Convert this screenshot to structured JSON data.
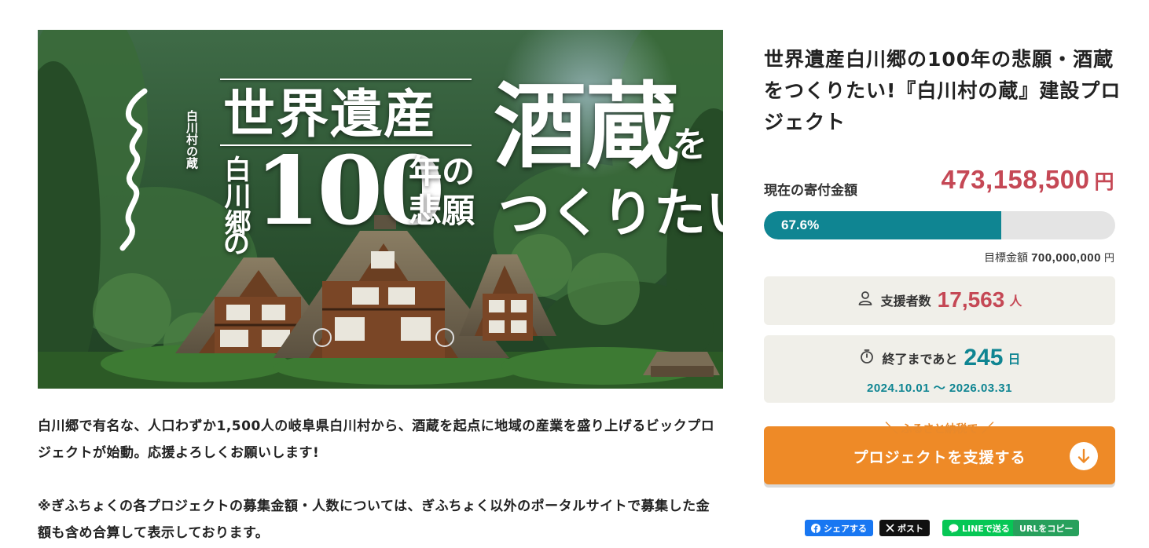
{
  "hero": {
    "alt": "世界遺産白川郷の100年の悲願 酒蔵をつくりたい!",
    "heritage": "世界遺産",
    "village": "白川郷",
    "of": "の",
    "hundred": "100",
    "years": "年の",
    "wish": "悲願",
    "sake": "酒蔵",
    "wo": "を",
    "want": "つくりたい!",
    "brand": "白川村の蔵"
  },
  "description": {
    "para1": "白川郷で有名な、人口わずか1,500人の岐阜県白川村から、酒蔵を起点に地域の産業を盛り上げるビックプロジェクトが始動。応援よろしくお願いします!",
    "para2": "※ぎふちょくの各プロジェクトの募集金額・人数については、ぎふちょく以外のポータルサイトで募集した金額も含め合算して表示しております。"
  },
  "project": {
    "title": "世界遺産白川郷の100年の悲願・酒蔵をつくりたい!『白川村の蔵』建設プロジェクト"
  },
  "funding": {
    "label": "現在の寄付金額",
    "amount": "473,158,500",
    "unit": "円",
    "percent": "67.6%",
    "percent_value": 67.6,
    "goal_label": "目標金額",
    "goal_amount": "700,000,000",
    "goal_unit": "円"
  },
  "supporters": {
    "label": "支援者数",
    "count": "17,563",
    "unit": "人"
  },
  "remaining": {
    "label": "終了まであと",
    "days": "245",
    "unit": "日",
    "period": "2024.10.01 ～ 2026.03.31"
  },
  "cta": {
    "badge": "ふるさと納税で",
    "label": "プロジェクトを支援する"
  },
  "share": {
    "facebook": "シェアする",
    "x": "ポスト",
    "line": "LINEで送る",
    "url": "URLをコピー"
  },
  "colors": {
    "accent_red": "#c54855",
    "accent_teal": "#0f8592",
    "cta_orange": "#ee8a27",
    "card_bg": "#f0efe9"
  },
  "icons": {
    "supporters": "person-icon",
    "remaining": "stopwatch-icon",
    "cta": "arrow-down-circle-icon"
  }
}
